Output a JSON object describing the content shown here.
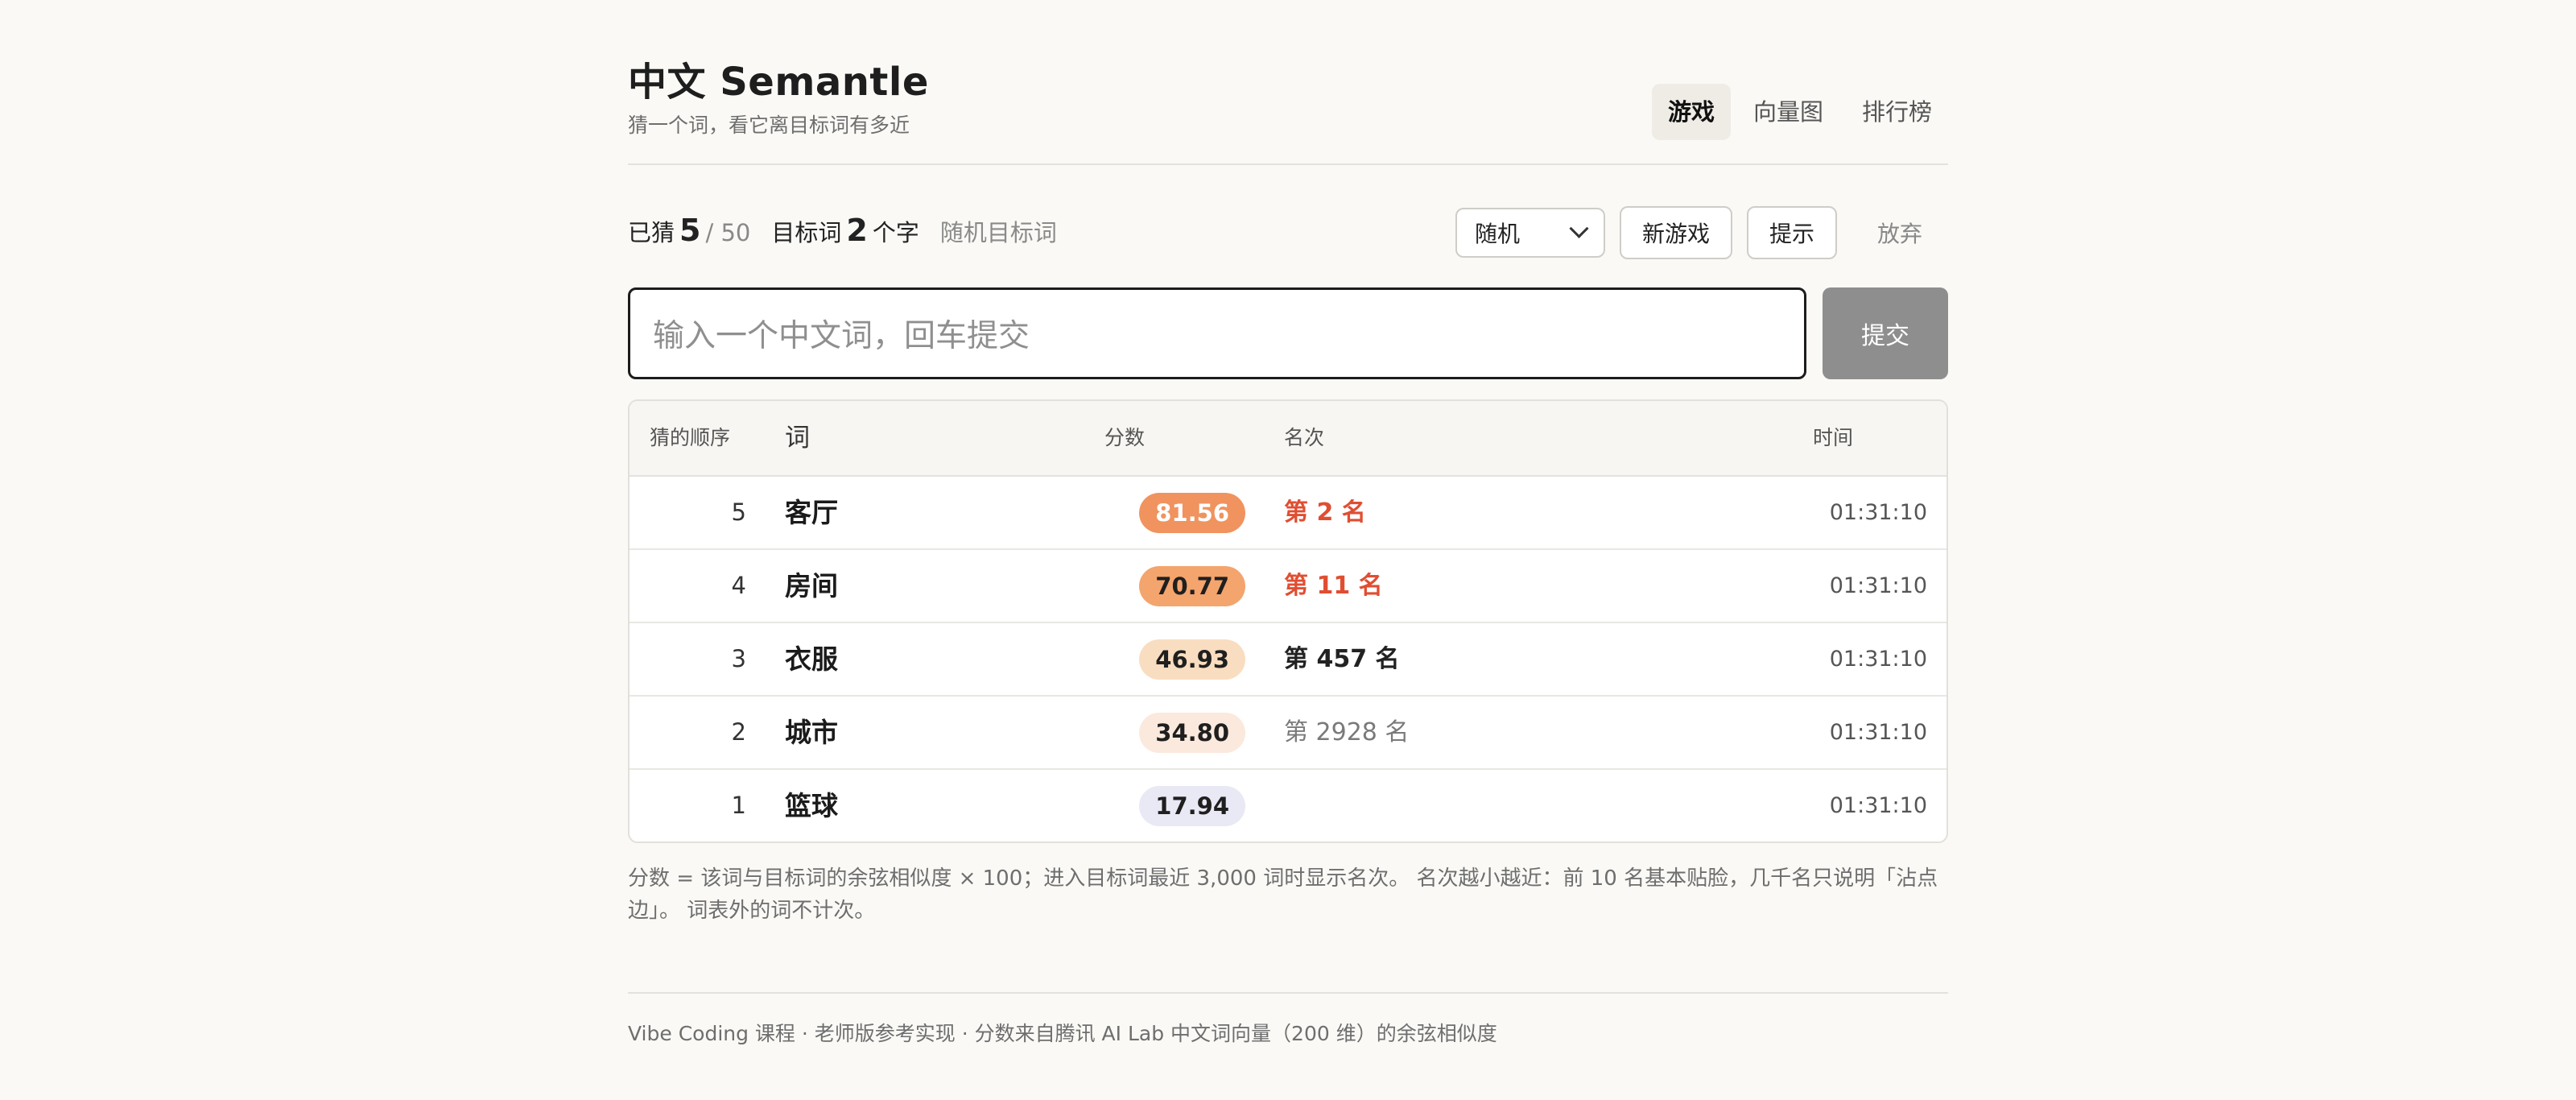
{
  "header": {
    "title": "中文 Semantle",
    "subtitle": "猜一个词，看它离目标词有多近",
    "tabs": [
      {
        "label": "游戏",
        "active": true
      },
      {
        "label": "向量图",
        "active": false
      },
      {
        "label": "排行榜",
        "active": false
      }
    ]
  },
  "status": {
    "guessed_label": "已猜",
    "guessed_count": "5",
    "guessed_total": "/ 50",
    "target_label": "目标词",
    "target_length": "2",
    "target_unit": "个字",
    "mode_label": "随机目标词"
  },
  "controls": {
    "select_value": "随机",
    "new_game_label": "新游戏",
    "hint_label": "提示",
    "give_up_label": "放弃"
  },
  "input": {
    "placeholder": "输入一个中文词，回车提交",
    "submit_label": "提交"
  },
  "table": {
    "headers": {
      "order": "猜的顺序",
      "word": "词",
      "score": "分数",
      "rank": "名次",
      "time": "时间"
    },
    "rows": [
      {
        "order": "5",
        "word": "客厅",
        "score": "81.56",
        "rank": "第 2 名",
        "time": "01:31:10",
        "pill_bg": "#f0935e",
        "pill_fg": "#ffffff",
        "rank_color": "#e04e32",
        "rank_weight": "700"
      },
      {
        "order": "4",
        "word": "房间",
        "score": "70.77",
        "rank": "第 11 名",
        "time": "01:31:10",
        "pill_bg": "#f4a46d",
        "pill_fg": "#1f1f1f",
        "rank_color": "#e04e32",
        "rank_weight": "700"
      },
      {
        "order": "3",
        "word": "衣服",
        "score": "46.93",
        "rank": "第 457 名",
        "time": "01:31:10",
        "pill_bg": "#f9ddc0",
        "pill_fg": "#1f1f1f",
        "rank_color": "#222222",
        "rank_weight": "600"
      },
      {
        "order": "2",
        "word": "城市",
        "score": "34.80",
        "rank": "第 2928 名",
        "time": "01:31:10",
        "pill_bg": "#fbe9dd",
        "pill_fg": "#1f1f1f",
        "rank_color": "#7a7a7a",
        "rank_weight": "400"
      },
      {
        "order": "1",
        "word": "篮球",
        "score": "17.94",
        "rank": "",
        "time": "01:31:10",
        "pill_bg": "#e9e9f5",
        "pill_fg": "#1f1f1f",
        "rank_color": "#7a7a7a",
        "rank_weight": "400"
      }
    ]
  },
  "note": "分数 = 该词与目标词的余弦相似度 × 100；进入目标词最近 3,000 词时显示名次。 名次越小越近：前 10 名基本贴脸，几千名只说明「沾点边」。 词表外的词不计次。",
  "footer": "Vibe Coding 课程 · 老师版参考实现 · 分数来自腾讯 AI Lab 中文词向量（200 维）的余弦相似度"
}
